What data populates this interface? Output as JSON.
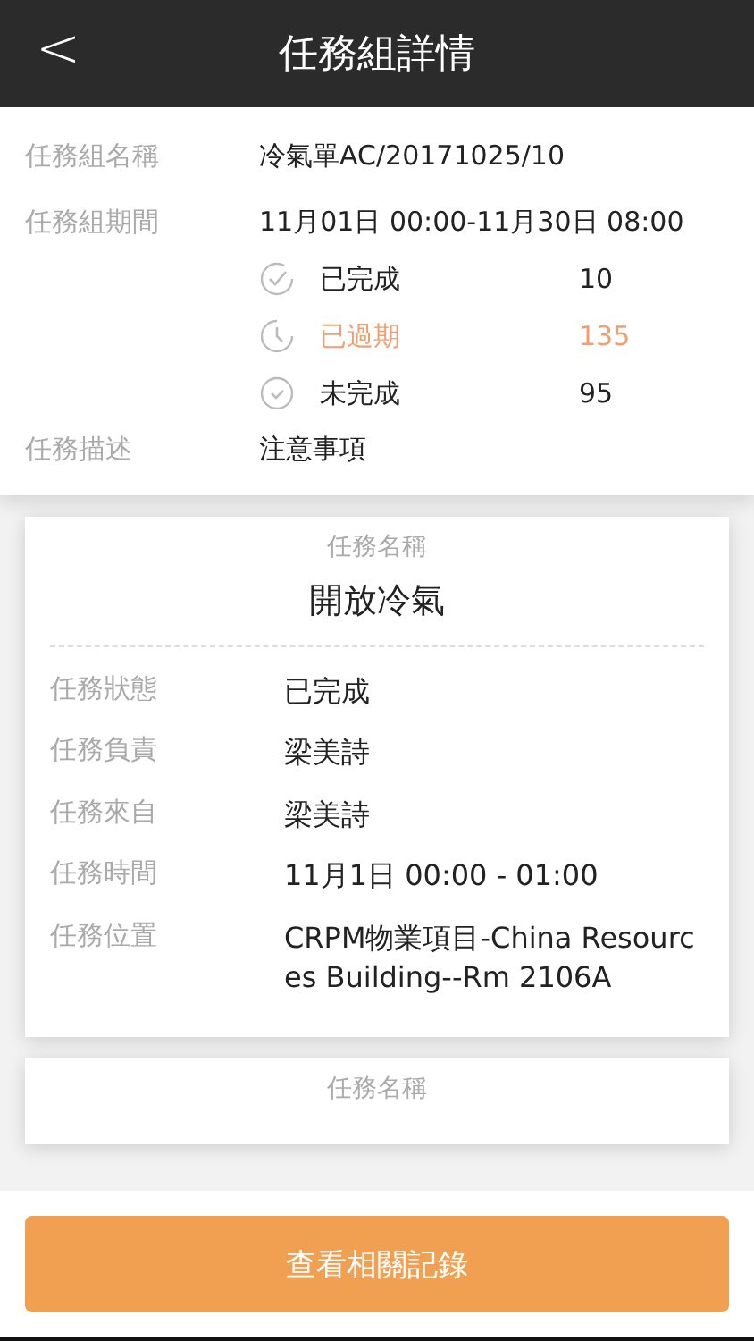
{
  "header": {
    "back": "<",
    "title": "任務組詳情"
  },
  "group": {
    "name_label": "任務組名稱",
    "name": "冷氣單AC/20171025/10",
    "period_label": "任務組期間",
    "period": "11月01日 00:00-11月30日 08:00",
    "stats": [
      {
        "kind": "done",
        "label": "已完成",
        "count": "10",
        "color": "#222222"
      },
      {
        "kind": "overdue",
        "label": "已過期",
        "count": "135",
        "color": "#f0a070"
      },
      {
        "kind": "pending",
        "label": "未完成",
        "count": "95",
        "color": "#222222"
      }
    ],
    "desc_label": "任務描述",
    "desc": "注意事項"
  },
  "tasks": [
    {
      "name_label": "任務名稱",
      "name": "開放冷氣",
      "fields": [
        {
          "label": "任務狀態",
          "value": "已完成"
        },
        {
          "label": "任務負責",
          "value": "梁美詩"
        },
        {
          "label": "任務來自",
          "value": "梁美詩"
        },
        {
          "label": "任務時間",
          "value": "11月1日 00:00 - 01:00"
        },
        {
          "label": "任務位置",
          "value": "CRPM物業項目-China Resources Building--Rm 2106A"
        }
      ]
    },
    {
      "name_label": "任務名稱"
    }
  ],
  "footer": {
    "button": "查看相關記錄"
  }
}
